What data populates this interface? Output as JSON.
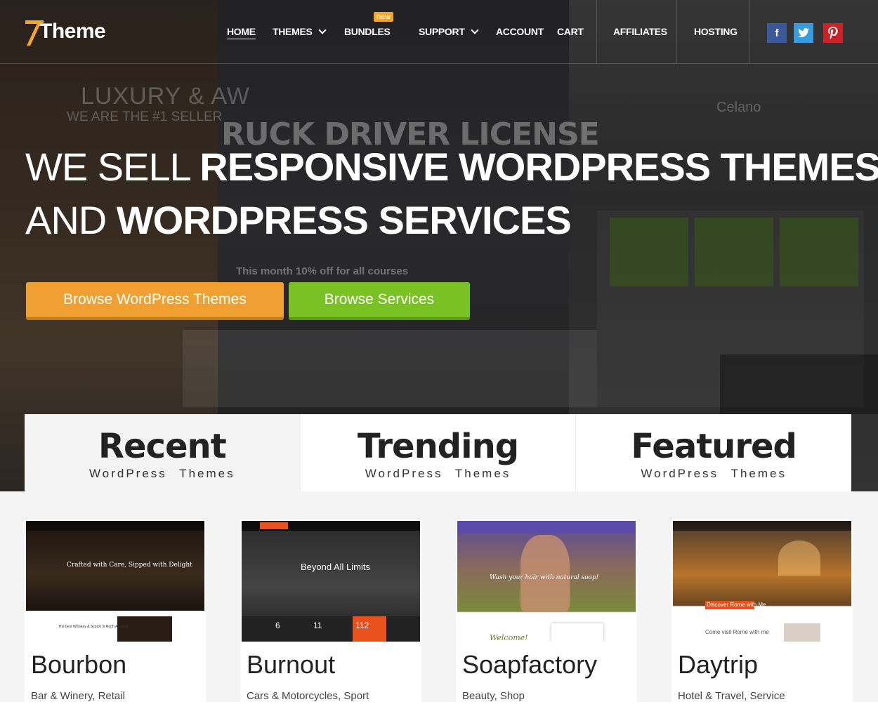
{
  "nav": {
    "logo_text": "Theme",
    "items": [
      {
        "label": "HOME"
      },
      {
        "label": "THEMES"
      },
      {
        "label": "BUNDLES",
        "badge": "new"
      },
      {
        "label": "SUPPORT"
      },
      {
        "label": "ACCOUNT"
      },
      {
        "label": "CART"
      },
      {
        "label": "AFFILIATES"
      },
      {
        "label": "HOSTING"
      }
    ],
    "social": [
      {
        "icon": "facebook-icon",
        "glyph": "f",
        "color": "#3b5998"
      },
      {
        "icon": "twitter-icon",
        "glyph": "t",
        "color": "#3a9be0"
      },
      {
        "icon": "pinterest-icon",
        "glyph": "P",
        "color": "#cc2127"
      }
    ]
  },
  "hero": {
    "line1_thin": "WE SELL",
    "line1_bold": "RESPONSIVE WORDPRESS THEMES",
    "line2_thin": "AND",
    "line2_bold": "WORDPRESS SERVICES",
    "cta_primary": "Browse WordPress Themes",
    "cta_secondary": "Browse Services",
    "colors": {
      "orange": "#f0a030",
      "green": "#7ac224"
    },
    "background_text": {
      "luxury": "LUXURY & AW",
      "seller": "WE ARE THE #1 SELLER",
      "truck": "RUCK DRIVER LICENSE",
      "celano": "Celano",
      "discount": "This month 10% off for all courses"
    }
  },
  "tabs": [
    {
      "title": "Recent",
      "subtitle": "WordPress Themes",
      "active": true
    },
    {
      "title": "Trending",
      "subtitle": "WordPress Themes",
      "active": false
    },
    {
      "title": "Featured",
      "subtitle": "WordPress Themes",
      "active": false
    }
  ],
  "themes": [
    {
      "name": "Bourbon",
      "categories": "Bar & Winery, Retail",
      "tagline": "Crafted with Care, Sipped with Delight",
      "note": "The best Whiskey & Scotch in North America"
    },
    {
      "name": "Burnout",
      "categories": "Cars & Motorcycles, Sport",
      "tagline": "Beyond All Limits",
      "stats": [
        "6",
        "11",
        "112"
      ]
    },
    {
      "name": "Soapfactory",
      "categories": "Beauty, Shop",
      "tagline": "Wash your hair with natural soap!",
      "note": "Welcome!"
    },
    {
      "name": "Daytrip",
      "categories": "Hotel & Travel, Service",
      "tagline": "Discover Rome with Me",
      "note": "Come visit Rome with me"
    }
  ]
}
